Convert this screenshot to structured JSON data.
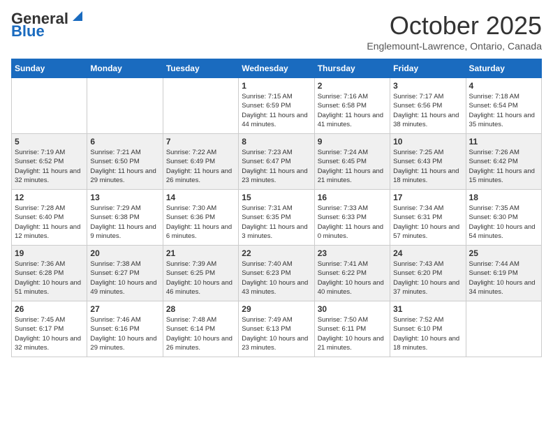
{
  "header": {
    "logo_general": "General",
    "logo_blue": "Blue",
    "month": "October 2025",
    "location": "Englemount-Lawrence, Ontario, Canada"
  },
  "weekdays": [
    "Sunday",
    "Monday",
    "Tuesday",
    "Wednesday",
    "Thursday",
    "Friday",
    "Saturday"
  ],
  "weeks": [
    [
      {
        "day": "",
        "info": ""
      },
      {
        "day": "",
        "info": ""
      },
      {
        "day": "",
        "info": ""
      },
      {
        "day": "1",
        "info": "Sunrise: 7:15 AM\nSunset: 6:59 PM\nDaylight: 11 hours and 44 minutes."
      },
      {
        "day": "2",
        "info": "Sunrise: 7:16 AM\nSunset: 6:58 PM\nDaylight: 11 hours and 41 minutes."
      },
      {
        "day": "3",
        "info": "Sunrise: 7:17 AM\nSunset: 6:56 PM\nDaylight: 11 hours and 38 minutes."
      },
      {
        "day": "4",
        "info": "Sunrise: 7:18 AM\nSunset: 6:54 PM\nDaylight: 11 hours and 35 minutes."
      }
    ],
    [
      {
        "day": "5",
        "info": "Sunrise: 7:19 AM\nSunset: 6:52 PM\nDaylight: 11 hours and 32 minutes."
      },
      {
        "day": "6",
        "info": "Sunrise: 7:21 AM\nSunset: 6:50 PM\nDaylight: 11 hours and 29 minutes."
      },
      {
        "day": "7",
        "info": "Sunrise: 7:22 AM\nSunset: 6:49 PM\nDaylight: 11 hours and 26 minutes."
      },
      {
        "day": "8",
        "info": "Sunrise: 7:23 AM\nSunset: 6:47 PM\nDaylight: 11 hours and 23 minutes."
      },
      {
        "day": "9",
        "info": "Sunrise: 7:24 AM\nSunset: 6:45 PM\nDaylight: 11 hours and 21 minutes."
      },
      {
        "day": "10",
        "info": "Sunrise: 7:25 AM\nSunset: 6:43 PM\nDaylight: 11 hours and 18 minutes."
      },
      {
        "day": "11",
        "info": "Sunrise: 7:26 AM\nSunset: 6:42 PM\nDaylight: 11 hours and 15 minutes."
      }
    ],
    [
      {
        "day": "12",
        "info": "Sunrise: 7:28 AM\nSunset: 6:40 PM\nDaylight: 11 hours and 12 minutes."
      },
      {
        "day": "13",
        "info": "Sunrise: 7:29 AM\nSunset: 6:38 PM\nDaylight: 11 hours and 9 minutes."
      },
      {
        "day": "14",
        "info": "Sunrise: 7:30 AM\nSunset: 6:36 PM\nDaylight: 11 hours and 6 minutes."
      },
      {
        "day": "15",
        "info": "Sunrise: 7:31 AM\nSunset: 6:35 PM\nDaylight: 11 hours and 3 minutes."
      },
      {
        "day": "16",
        "info": "Sunrise: 7:33 AM\nSunset: 6:33 PM\nDaylight: 11 hours and 0 minutes."
      },
      {
        "day": "17",
        "info": "Sunrise: 7:34 AM\nSunset: 6:31 PM\nDaylight: 10 hours and 57 minutes."
      },
      {
        "day": "18",
        "info": "Sunrise: 7:35 AM\nSunset: 6:30 PM\nDaylight: 10 hours and 54 minutes."
      }
    ],
    [
      {
        "day": "19",
        "info": "Sunrise: 7:36 AM\nSunset: 6:28 PM\nDaylight: 10 hours and 51 minutes."
      },
      {
        "day": "20",
        "info": "Sunrise: 7:38 AM\nSunset: 6:27 PM\nDaylight: 10 hours and 49 minutes."
      },
      {
        "day": "21",
        "info": "Sunrise: 7:39 AM\nSunset: 6:25 PM\nDaylight: 10 hours and 46 minutes."
      },
      {
        "day": "22",
        "info": "Sunrise: 7:40 AM\nSunset: 6:23 PM\nDaylight: 10 hours and 43 minutes."
      },
      {
        "day": "23",
        "info": "Sunrise: 7:41 AM\nSunset: 6:22 PM\nDaylight: 10 hours and 40 minutes."
      },
      {
        "day": "24",
        "info": "Sunrise: 7:43 AM\nSunset: 6:20 PM\nDaylight: 10 hours and 37 minutes."
      },
      {
        "day": "25",
        "info": "Sunrise: 7:44 AM\nSunset: 6:19 PM\nDaylight: 10 hours and 34 minutes."
      }
    ],
    [
      {
        "day": "26",
        "info": "Sunrise: 7:45 AM\nSunset: 6:17 PM\nDaylight: 10 hours and 32 minutes."
      },
      {
        "day": "27",
        "info": "Sunrise: 7:46 AM\nSunset: 6:16 PM\nDaylight: 10 hours and 29 minutes."
      },
      {
        "day": "28",
        "info": "Sunrise: 7:48 AM\nSunset: 6:14 PM\nDaylight: 10 hours and 26 minutes."
      },
      {
        "day": "29",
        "info": "Sunrise: 7:49 AM\nSunset: 6:13 PM\nDaylight: 10 hours and 23 minutes."
      },
      {
        "day": "30",
        "info": "Sunrise: 7:50 AM\nSunset: 6:11 PM\nDaylight: 10 hours and 21 minutes."
      },
      {
        "day": "31",
        "info": "Sunrise: 7:52 AM\nSunset: 6:10 PM\nDaylight: 10 hours and 18 minutes."
      },
      {
        "day": "",
        "info": ""
      }
    ]
  ]
}
